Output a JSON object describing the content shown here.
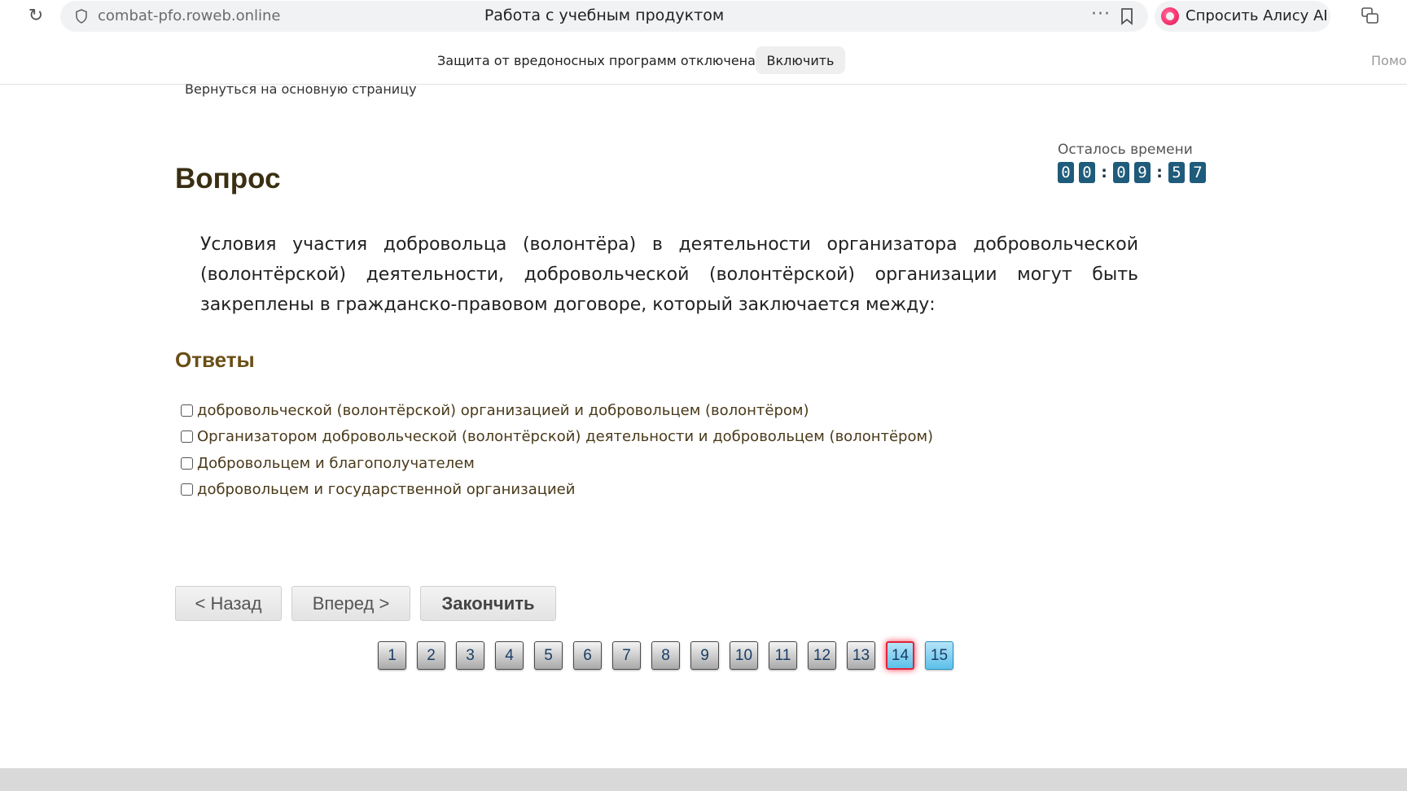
{
  "browser": {
    "url": "combat-pfo.roweb.online",
    "tab_title": "Работа с учебным продуктом",
    "alice_label": "Спросить Алису AI",
    "menu_dots": "···"
  },
  "banner": {
    "text": "Защита от вредоносных программ отключена",
    "enable_label": "Включить",
    "help_label": "Помо"
  },
  "page": {
    "back_link": "Вернуться на основную страницу",
    "question_heading": "Вопрос",
    "question_text": "Условия участия добровольца (волонтёра) в деятельности организатора добровольческой (волонтёрской) деятельности, добровольческой (волонтёрской) организации могут быть закреплены в гражданско-правовом договоре, который заключается между:",
    "answers_heading": "Ответы",
    "answers": [
      "добровольческой (волонтёрской) организацией и добровольцем (волонтёром)",
      "Организатором добровольческой (волонтёрской) деятельности и добровольцем (волонтёром)",
      "Добровольцем и благополучателем",
      "добровольцем и государственной организацией"
    ],
    "timer": {
      "label": "Осталось времени",
      "digits": [
        "0",
        "0",
        "0",
        "9",
        "5",
        "7"
      ],
      "separator": ":"
    },
    "buttons": {
      "back": "< Назад",
      "next": "Вперед >",
      "finish": "Закончить"
    },
    "pages": [
      "1",
      "2",
      "3",
      "4",
      "5",
      "6",
      "7",
      "8",
      "9",
      "10",
      "11",
      "12",
      "13",
      "14",
      "15"
    ],
    "current_page": "14"
  }
}
